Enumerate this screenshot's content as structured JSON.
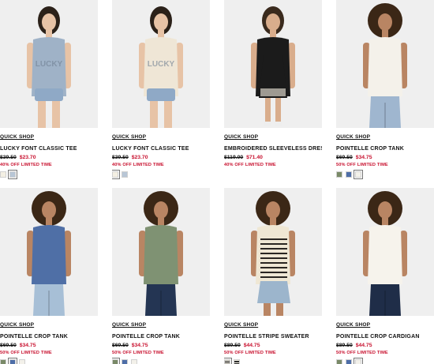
{
  "products": [
    {
      "quick_shop": "QUICK SHOP",
      "name": "LUCKY FONT CLASSIC TEE",
      "was": "$39.50",
      "now": "$23.70",
      "promo": "40% OFF LIMITED TIME",
      "model": {
        "top": "#9fb2c7",
        "bottom": "#8fa9c6",
        "skin": "#e7c3a6",
        "hair": "#2b2119",
        "print": "LUCKY",
        "legs": "shorts"
      },
      "swatches": [
        "#f3efe3",
        "#b8c6d6"
      ],
      "selected_swatch": 1
    },
    {
      "quick_shop": "QUICK SHOP",
      "name": "LUCKY FONT CLASSIC TEE",
      "was": "$39.50",
      "now": "$23.70",
      "promo": "40% OFF LIMITED TIME",
      "model": {
        "top": "#efe6d6",
        "bottom": "#8fa9c6",
        "skin": "#e7c3a6",
        "hair": "#2b2119",
        "print": "LUCKY",
        "legs": "shorts"
      },
      "swatches": [
        "#f3efe3",
        "#b8c6d6"
      ],
      "selected_swatch": 0
    },
    {
      "quick_shop": "QUICK SHOP",
      "name": "EMBROIDERED SLEEVELESS DRESS",
      "was": "$119.00",
      "now": "$71.40",
      "promo": "40% OFF LIMITED TIME",
      "model": {
        "top": "#1b1b1b",
        "bottom": "#1b1b1b",
        "skin": "#d9ad8c",
        "hair": "#3a2a1d",
        "print": "",
        "legs": "dress"
      },
      "swatches": [],
      "selected_swatch": -1
    },
    {
      "quick_shop": "QUICK SHOP",
      "name": "POINTELLE CROP TANK",
      "was": "$69.50",
      "now": "$34.75",
      "promo": "50% OFF LIMITED TIME",
      "model": {
        "top": "#f4f1ea",
        "bottom": "#9fb6cf",
        "skin": "#b98563",
        "hair": "#3b2716",
        "print": "",
        "legs": "jeans"
      },
      "swatches": [
        "#7a8a68",
        "#4e6ea8",
        "#f3f1ea"
      ],
      "selected_swatch": 2
    },
    {
      "quick_shop": "QUICK SHOP",
      "name": "POINTELLE CROP TANK",
      "was": "$69.50",
      "now": "$34.75",
      "promo": "50% OFF LIMITED TIME",
      "model": {
        "top": "#4f6fa6",
        "bottom": "#a7bfd6",
        "skin": "#b98563",
        "hair": "#3b2716",
        "print": "",
        "legs": "jeans"
      },
      "swatches": [
        "#7a8a68",
        "#4e6ea8",
        "#f3f1ea"
      ],
      "selected_swatch": 1
    },
    {
      "quick_shop": "QUICK SHOP",
      "name": "POINTELLE CROP TANK",
      "was": "$69.50",
      "now": "$34.75",
      "promo": "50% OFF LIMITED TIME",
      "model": {
        "top": "#7f9273",
        "bottom": "#243553",
        "skin": "#b98563",
        "hair": "#3b2716",
        "print": "",
        "legs": "jeans"
      },
      "swatches": [
        "#7a8a68",
        "#4e6ea8",
        "#f3f1ea"
      ],
      "selected_swatch": 0
    },
    {
      "quick_shop": "QUICK SHOP",
      "name": "POINTELLE STRIPE SWEATER",
      "was": "$89.50",
      "now": "$44.75",
      "promo": "50% OFF LIMITED TIME",
      "model": {
        "top": "#efe7d4",
        "bottom": "#9cb5cc",
        "skin": "#b98563",
        "hair": "#3b2716",
        "print": "",
        "legs": "skirt",
        "stripes": "#2a2622"
      },
      "swatches": [
        "#2b2b2b",
        "#2b2b2b"
      ],
      "selected_swatch": 0
    },
    {
      "quick_shop": "QUICK SHOP",
      "name": "POINTELLE CROP CARDIGAN",
      "was": "$89.50",
      "now": "$44.75",
      "promo": "50% OFF LIMITED TIME",
      "model": {
        "top": "#f6f3ec",
        "bottom": "#1f2d48",
        "skin": "#b98563",
        "hair": "#3b2716",
        "print": "",
        "legs": "jeans"
      },
      "swatches": [
        "#7a8a68",
        "#4e6ea8",
        "#f3f1ea"
      ],
      "selected_swatch": 2
    }
  ]
}
